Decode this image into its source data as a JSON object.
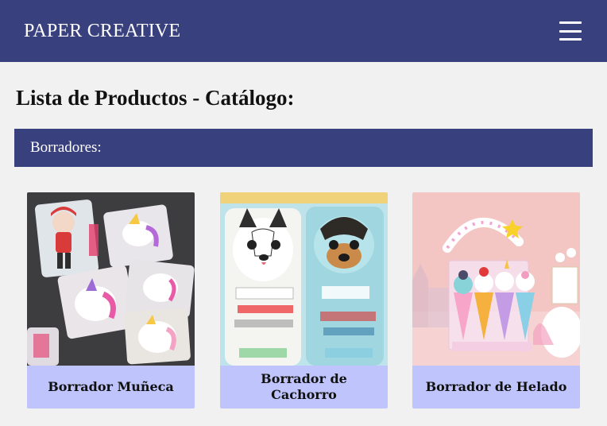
{
  "header": {
    "brand": "PAPER CREATIVE",
    "menu_icon": "hamburger-menu-icon"
  },
  "main": {
    "title": "Lista de Productos - Catálogo:",
    "section": {
      "label": "Borradores:"
    },
    "products": [
      {
        "name": "Borrador Muñeca"
      },
      {
        "name": "Borrador de Cachorro"
      },
      {
        "name": "Borrador de Helado"
      }
    ]
  },
  "colors": {
    "header_bg": "#39407e",
    "caption_bg": "#bfc5fc",
    "page_bg": "#f1f1f1"
  }
}
